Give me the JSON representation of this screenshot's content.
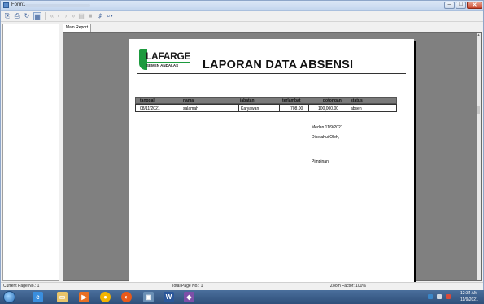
{
  "window": {
    "title": "Form1",
    "controls": {
      "minimize": "–",
      "maximize": "□",
      "close": "✕"
    }
  },
  "toolbar": {
    "icons": [
      "export-icon",
      "print-icon",
      "refresh-icon",
      "group-tree-icon",
      "first-page-icon",
      "prev-page-icon",
      "next-page-icon",
      "last-page-icon",
      "goto-page-icon",
      "stop-icon",
      "search-icon",
      "zoom-icon"
    ]
  },
  "tabs": {
    "main": "Main Report"
  },
  "report": {
    "logo": {
      "word": "LAFARGE",
      "subtitle": "SEMEN ANDALAS"
    },
    "title": "LAPORAN DATA ABSENSI",
    "table": {
      "headers": [
        "tanggal",
        "nama",
        "jabatan",
        "terlambat",
        "potongan",
        "status"
      ],
      "rows": [
        [
          "08/11/2021",
          "salamah",
          "Karyawan",
          "708.00",
          "100,000.00",
          "absen"
        ]
      ]
    },
    "footer": {
      "place_date": "Medan    11/9/2021",
      "known_by": "Diketahui Oleh,",
      "signatory": "Pimpinan"
    }
  },
  "statusbar": {
    "current_page": "Current Page No.: 1",
    "total_page": "Total Page No.: 1",
    "zoom": "Zoom Factor: 100%"
  },
  "taskbar": {
    "apps": [
      "ie-icon",
      "file-explorer-icon",
      "media-player-icon",
      "chrome-icon",
      "firefox-icon",
      "vb-icon",
      "word-icon",
      "visual-studio-icon"
    ],
    "clock_time": "12:34 AM",
    "clock_date": "11/9/2021"
  },
  "colors": {
    "accent_green": "#1d9a3e",
    "table_header": "#7a7a7a",
    "taskbar": "#2f4f7a"
  }
}
